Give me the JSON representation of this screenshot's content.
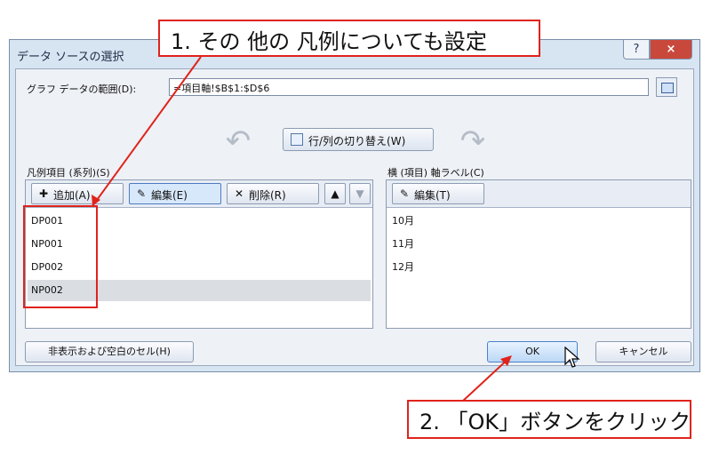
{
  "dialog": {
    "title": "データ ソースの選択",
    "help_label": "?",
    "close_label": "×",
    "range_label": "グラフ データの範囲(D):",
    "range_value": "=項目軸!$B$1:$D$6",
    "switch_label": "行/列の切り替え(W)",
    "arrow_left_glyph": "↶",
    "arrow_right_glyph": "↷"
  },
  "legend_panel": {
    "label": "凡例項目 (系列)(S)",
    "add_label": "追加(A)",
    "edit_label": "編集(E)",
    "delete_label": "削除(R)",
    "up_label": "▲",
    "down_label": "▼",
    "items": [
      "DP001",
      "NP001",
      "DP002",
      "NP002"
    ],
    "selected_index": 3
  },
  "axis_panel": {
    "label": "横 (項目) 軸ラベル(C)",
    "edit_label": "編集(T)",
    "items": [
      "10月",
      "11月",
      "12月"
    ]
  },
  "footer": {
    "hidden_cells_label": "非表示および空白のセル(H)",
    "ok_label": "OK",
    "cancel_label": "キャンセル"
  },
  "annotations": {
    "callout1": "1. その 他の 凡例についても設定",
    "callout2": "2. 「OK」ボタンをクリック",
    "highlight_color": "#e0231b"
  }
}
